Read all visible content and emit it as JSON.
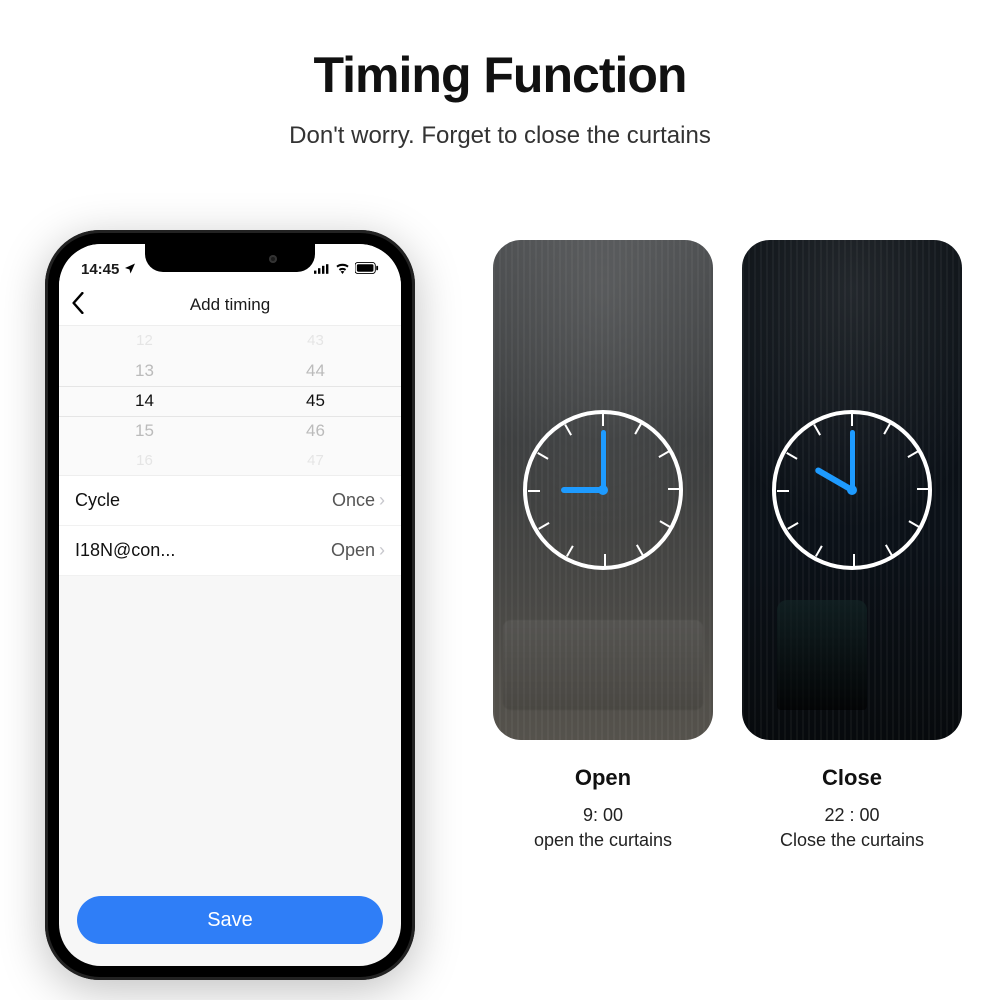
{
  "hero": {
    "title": "Timing Function",
    "sub": "Don't worry. Forget to close the curtains"
  },
  "phone": {
    "status_time": "14:45",
    "nav_title": "Add timing",
    "picker": {
      "hours": [
        "12",
        "13",
        "14",
        "15",
        "16"
      ],
      "mins": [
        "43",
        "44",
        "45",
        "46",
        "47"
      ],
      "selected_hour": "14",
      "selected_min": "45"
    },
    "rows": [
      {
        "label": "Cycle",
        "value": "Once"
      },
      {
        "label": "I18N@con...",
        "value": "Open"
      }
    ],
    "save_label": "Save"
  },
  "cards": {
    "open": {
      "title": "Open",
      "time": "9: 00",
      "desc": "open the curtains",
      "hour_angle": 270,
      "min_angle": 0
    },
    "close": {
      "title": "Close",
      "time": "22 : 00",
      "desc": "Close the curtains",
      "hour_angle": 300,
      "min_angle": 0
    }
  }
}
